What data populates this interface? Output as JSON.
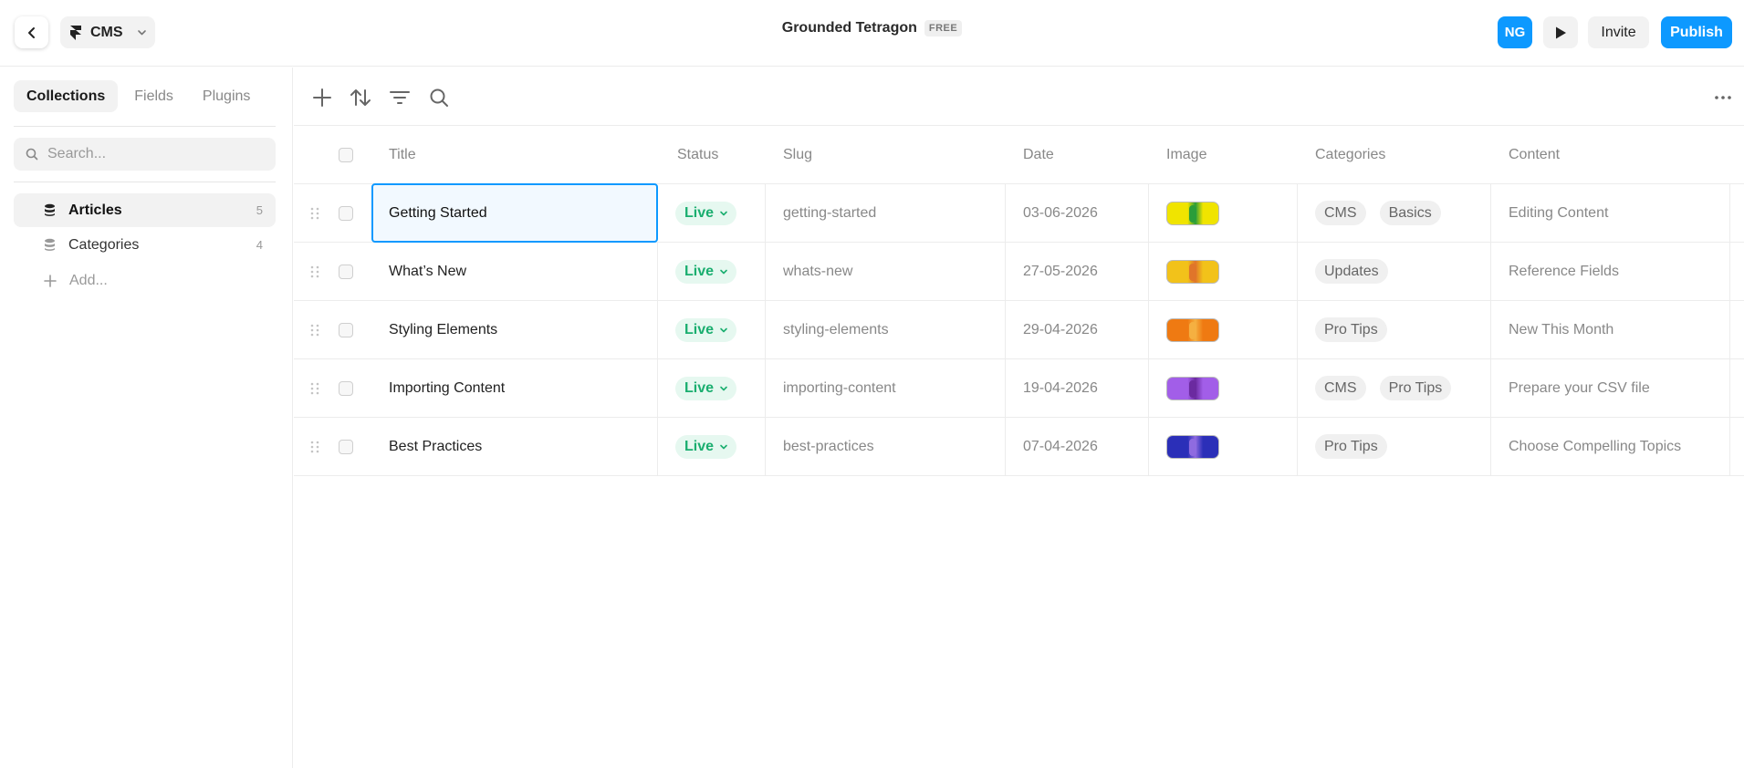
{
  "topbar": {
    "app_menu_label": "CMS",
    "project_name": "Grounded Tetragon",
    "plan_badge": "FREE",
    "avatar_initials": "NG",
    "invite_label": "Invite",
    "publish_label": "Publish"
  },
  "sidebar": {
    "tabs": [
      {
        "label": "Collections",
        "active": true
      },
      {
        "label": "Fields",
        "active": false
      },
      {
        "label": "Plugins",
        "active": false
      }
    ],
    "search_placeholder": "Search...",
    "collections": [
      {
        "label": "Articles",
        "count": "5",
        "active": true
      },
      {
        "label": "Categories",
        "count": "4",
        "active": false
      }
    ],
    "add_label": "Add..."
  },
  "table": {
    "columns": [
      "Title",
      "Status",
      "Slug",
      "Date",
      "Image",
      "Categories",
      "Content"
    ],
    "rows": [
      {
        "title": "Getting Started",
        "status": "Live",
        "slug": "getting-started",
        "date": "03-06-2026",
        "image_colors": [
          "#f0e400",
          "#2a9d3a"
        ],
        "categories": [
          "CMS",
          "Basics"
        ],
        "content": "Editing Content"
      },
      {
        "title": "What’s New",
        "status": "Live",
        "slug": "whats-new",
        "date": "27-05-2026",
        "image_colors": [
          "#f2c21a",
          "#e0752a"
        ],
        "categories": [
          "Updates"
        ],
        "content": "Reference Fields"
      },
      {
        "title": "Styling Elements",
        "status": "Live",
        "slug": "styling-elements",
        "date": "29-04-2026",
        "image_colors": [
          "#ef7a12",
          "#f5b041"
        ],
        "categories": [
          "Pro Tips"
        ],
        "content": "New This Month"
      },
      {
        "title": "Importing Content",
        "status": "Live",
        "slug": "importing-content",
        "date": "19-04-2026",
        "image_colors": [
          "#a25ee8",
          "#6b2aa0"
        ],
        "categories": [
          "CMS",
          "Pro Tips"
        ],
        "content": "Prepare your CSV file"
      },
      {
        "title": "Best Practices",
        "status": "Live",
        "slug": "best-practices",
        "date": "07-04-2026",
        "image_colors": [
          "#2b2fb8",
          "#8f6be0"
        ],
        "categories": [
          "Pro Tips"
        ],
        "content": "Choose Compelling Topics"
      }
    ]
  },
  "colors": {
    "accent": "#0d99ff",
    "status_live_text": "#1aae6f",
    "status_live_bg": "#e6f8f0"
  },
  "icons": [
    "chevron-left-icon",
    "framer-logo-icon",
    "chevron-down-icon",
    "play-icon",
    "plus-icon",
    "sort-icon",
    "filter-icon",
    "search-icon",
    "more-icon",
    "database-icon",
    "drag-handle-icon"
  ]
}
